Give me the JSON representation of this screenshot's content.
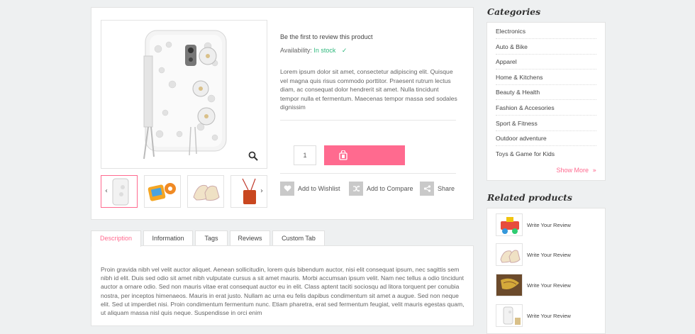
{
  "product": {
    "review_link": "Be the first to review this product",
    "availability_label": "Availability:",
    "availability_value": "In stock",
    "short_description": "Lorem ipsum dolor sit amet, consectetur adipiscing elit. Quisque vel magna quis risus commodo porttitor. Praesent rutrum lectus diam, ac consequat dolor hendrerit sit amet. Nulla tincidunt tempor nulla et fermentum. Maecenas tempor massa sed sodales dignissim",
    "quantity": "1",
    "cart_icon": "shopping-bag-icon",
    "actions": [
      {
        "label": "Add to Wishlist",
        "icon": "heart-icon"
      },
      {
        "label": "Add to Compare",
        "icon": "shuffle-icon"
      },
      {
        "label": "Share",
        "icon": "share-icon"
      }
    ]
  },
  "tabs": [
    "Description",
    "Information",
    "Tags",
    "Reviews",
    "Custom Tab"
  ],
  "active_tab": "Description",
  "description_text": "Proin gravida nibh vel velit auctor aliquet. Aenean sollicitudin, lorem quis bibendum auctor, nisi elit consequat ipsum, nec sagittis sem nibh id elit. Duis sed odio sit amet nibh vulputate cursus a sit amet mauris. Morbi accumsan ipsum velit. Nam nec tellus a odio tincidunt auctor a ornare odio. Sed non mauris vitae erat consequat auctor eu in elit. Class aptent taciti sociosqu ad litora torquent per conubia nostra, per inceptos himenaeos. Mauris in erat justo. Nullam ac urna eu felis dapibus condimentum sit amet a augue. Sed non neque elit. Sed ut imperdiet nisi. Proin condimentum fermentum nunc. Etiam pharetra, erat sed fermentum feugiat, velit mauris egestas quam, ut aliquam massa nisl quis neque. Suspendisse in orci enim",
  "sidebar": {
    "categories_title": "Categories",
    "categories": [
      "Electronics",
      "Auto & Bike",
      "Apparel",
      "Home & Kitchens",
      "Beauty & Health",
      "Fashion & Accesories",
      "Sport & Fitness",
      "Outdoor adventure",
      "Toys & Game for Kids"
    ],
    "show_more": "Show More",
    "related_title": "Related products",
    "related": [
      "Write Your Review",
      "Write Your Review",
      "Write Your Review",
      "Write Your Review"
    ]
  },
  "colors": {
    "accent": "#ff6a8f",
    "in_stock": "#2fb87d",
    "icon_bg": "#c9c9c9"
  }
}
